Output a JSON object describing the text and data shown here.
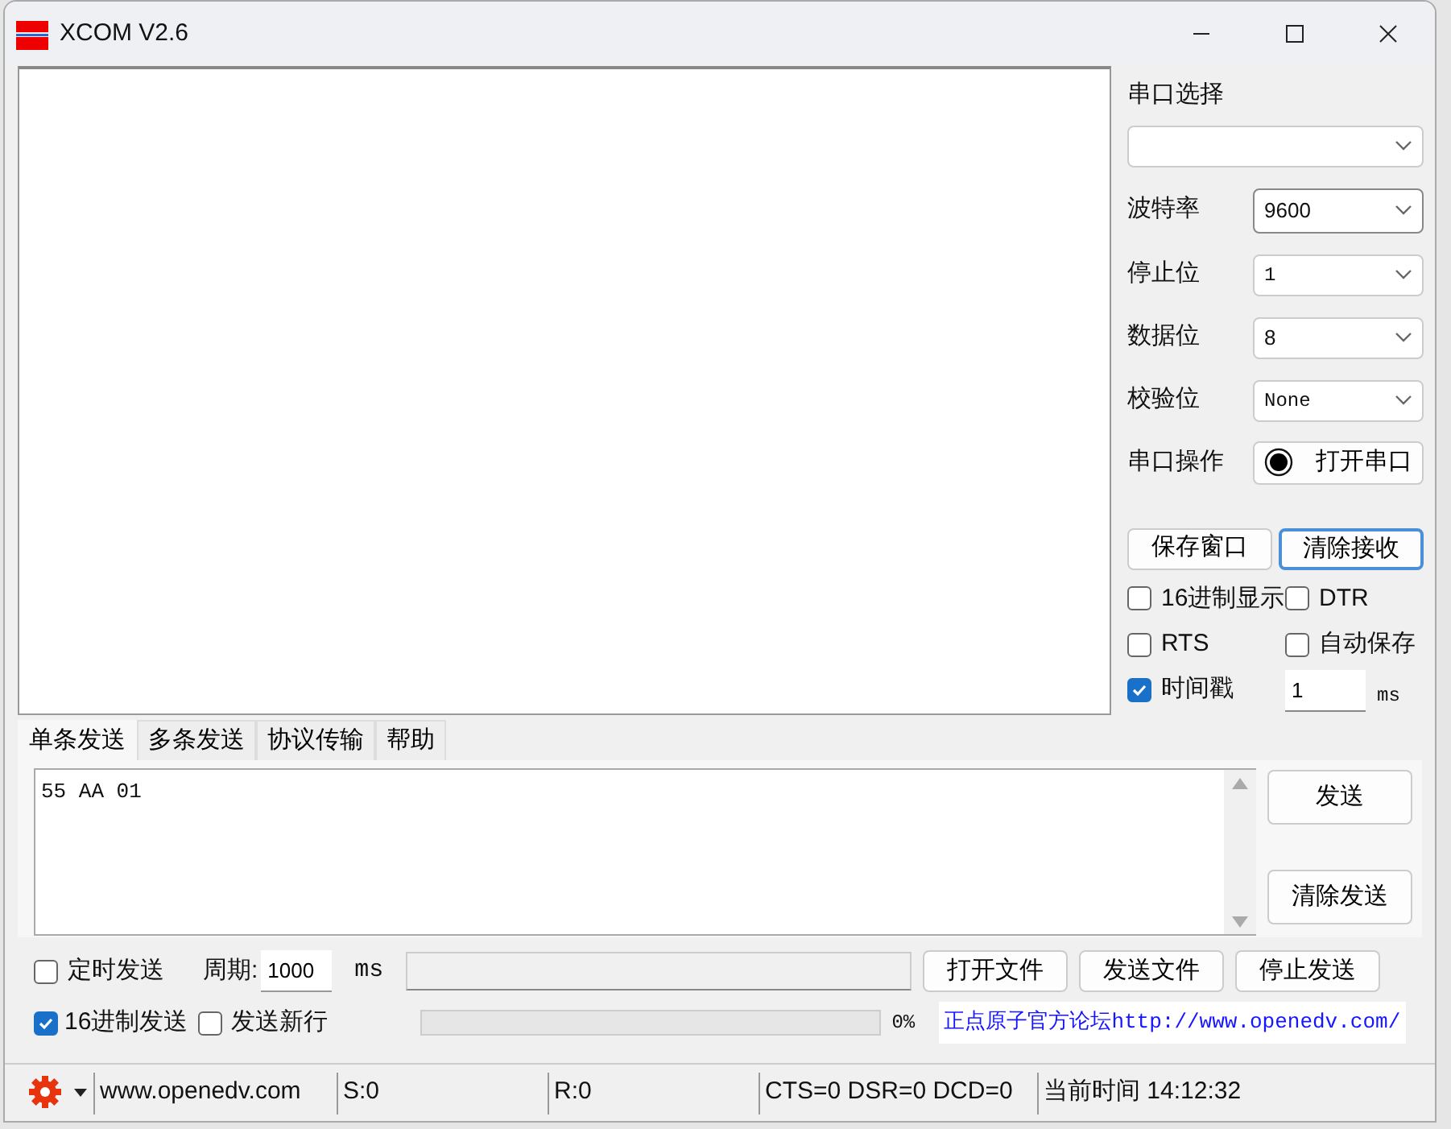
{
  "window": {
    "title": "XCOM V2.6"
  },
  "serial": {
    "port_label": "串口选择",
    "fields": [
      {
        "label": "波特率",
        "value": "9600",
        "kind": "sans",
        "focused": true
      },
      {
        "label": "停止位",
        "value": "1",
        "kind": "mono",
        "focused": false
      },
      {
        "label": "数据位",
        "value": "8",
        "kind": "sans",
        "focused": false
      },
      {
        "label": "校验位",
        "value": "None",
        "kind": "mono",
        "focused": false
      }
    ],
    "operation": {
      "label": "串口操作",
      "button": "打开串口"
    }
  },
  "receive_buttons": [
    {
      "label": "保存窗口",
      "focused": false
    },
    {
      "label": "清除接收",
      "focused": true
    }
  ],
  "options": [
    {
      "label": "16进制显示",
      "checked": false
    },
    {
      "label": "DTR",
      "checked": false
    },
    {
      "label": "RTS",
      "checked": false
    },
    {
      "label": "自动保存",
      "checked": false
    }
  ],
  "timestamp": {
    "label": "时间戳",
    "checked": true,
    "value": "1",
    "unit": "ms"
  },
  "tabs": [
    {
      "label": "单条发送",
      "selected": true
    },
    {
      "label": "多条发送",
      "selected": false
    },
    {
      "label": "协议传输",
      "selected": false
    },
    {
      "label": "帮助",
      "selected": false
    }
  ],
  "send": {
    "text": "55 AA 01",
    "buttons": [
      "发送",
      "清除发送"
    ]
  },
  "timed_send": {
    "label": "定时发送",
    "checked": false
  },
  "period": {
    "label": "周期:",
    "value": "1000",
    "unit": "ms"
  },
  "hex_send": {
    "label": "16进制发送",
    "checked": true
  },
  "send_newline": {
    "label": "发送新行",
    "checked": false
  },
  "file_buttons": [
    "打开文件",
    "发送文件",
    "停止发送"
  ],
  "progress": {
    "level": 0,
    "reading": "0%"
  },
  "forum_link": "正点原子官方论坛http://www.openedv.com/",
  "status_bar": {
    "website": "www.openedv.com",
    "sent": "S:0",
    "received": "R:0",
    "signals": "CTS=0 DSR=0 DCD=0",
    "time": "当前时间 14:12:32"
  }
}
